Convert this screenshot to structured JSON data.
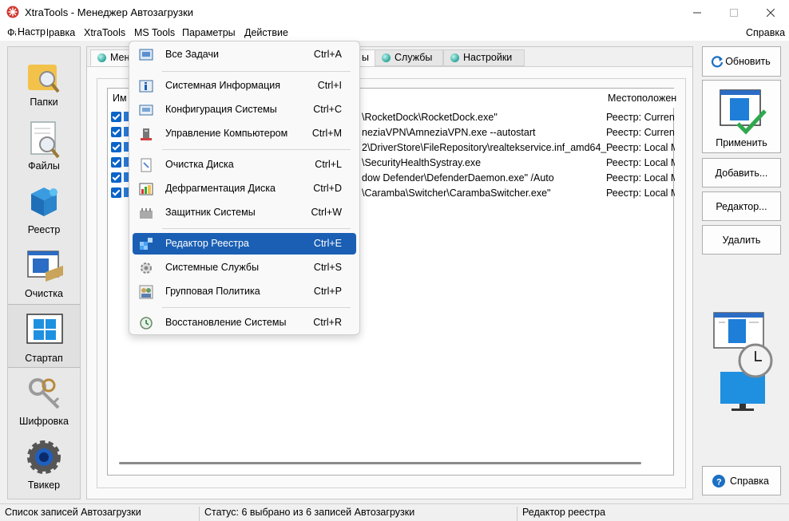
{
  "window": {
    "title": "XtraTools - Менеджер Автозагрузки"
  },
  "menubar": {
    "items": [
      "Файл",
      "Правка",
      "XtraTools",
      "MS Tools",
      "Параметры",
      "Действие"
    ],
    "help": "Справка"
  },
  "leftnav": {
    "items": [
      "Папки",
      "Файлы",
      "Реестр",
      "Очистка",
      "Стартап",
      "Шифровка",
      "Твикер"
    ]
  },
  "tabs": [
    "Менеджер Автозагрузки",
    "Службы",
    "Настройки"
  ],
  "tab_visible": {
    "first_fragment": "Мен",
    "second_fragment": "ы"
  },
  "group": {
    "label": "Настр"
  },
  "list": {
    "header_name": "Им",
    "header_location": "Местоположен",
    "rows": [
      {
        "path": "\\RocketDock\\RocketDock.exe\"",
        "location": "Реестр: Current"
      },
      {
        "path": "neziaVPN\\AmneziaVPN.exe --autostart",
        "location": "Реестр: Current"
      },
      {
        "path": "2\\DriverStore\\FileRepository\\realtekservice.inf_amd64_...",
        "location": "Реестр: Local M"
      },
      {
        "path": "\\SecurityHealthSystray.exe",
        "location": "Реестр: Local M"
      },
      {
        "path": "dow Defender\\DefenderDaemon.exe\" /Auto",
        "location": "Реестр: Local M"
      },
      {
        "path": "\\Caramba\\Switcher\\CarambaSwitcher.exe\"",
        "location": "Реестр: Local M"
      }
    ]
  },
  "buttons": {
    "refresh": "Обновить",
    "apply": "Применить",
    "add": "Добавить...",
    "editor": "Редактор...",
    "delete": "Удалить",
    "help": "Справка"
  },
  "status": {
    "left": "Список записей Автозагрузки",
    "middle": "Статус: 6 выбрано из 6 записей Автозагрузки",
    "right": "Редактор реестра"
  },
  "ms_tools_menu": {
    "items": [
      {
        "label": "Все Задачи",
        "shortcut": "Ctrl+A",
        "icon": "all-tasks-icon"
      },
      {
        "label": "Системная Информация",
        "shortcut": "Ctrl+I",
        "icon": "system-info-icon"
      },
      {
        "label": "Конфигурация Системы",
        "shortcut": "Ctrl+C",
        "icon": "system-config-icon"
      },
      {
        "label": "Управление Компьютером",
        "shortcut": "Ctrl+M",
        "icon": "computer-management-icon"
      },
      {
        "label": "Очистка Диска",
        "shortcut": "Ctrl+L",
        "icon": "disk-cleanup-icon"
      },
      {
        "label": "Дефрагментация Диска",
        "shortcut": "Ctrl+D",
        "icon": "defrag-icon"
      },
      {
        "label": "Защитник Системы",
        "shortcut": "Ctrl+W",
        "icon": "system-defender-icon"
      },
      {
        "label": "Редактор Реестра",
        "shortcut": "Ctrl+E",
        "icon": "registry-editor-icon"
      },
      {
        "label": "Системные Службы",
        "shortcut": "Ctrl+S",
        "icon": "system-services-icon"
      },
      {
        "label": "Групповая Политика",
        "shortcut": "Ctrl+P",
        "icon": "group-policy-icon"
      },
      {
        "label": "Восстановление Системы",
        "shortcut": "Ctrl+R",
        "icon": "system-restore-icon"
      }
    ],
    "highlighted_index": 7
  },
  "colors": {
    "accent": "#1a5fb4",
    "checkbox": "#0a64c8",
    "tab_dot": "#2aa59a"
  }
}
